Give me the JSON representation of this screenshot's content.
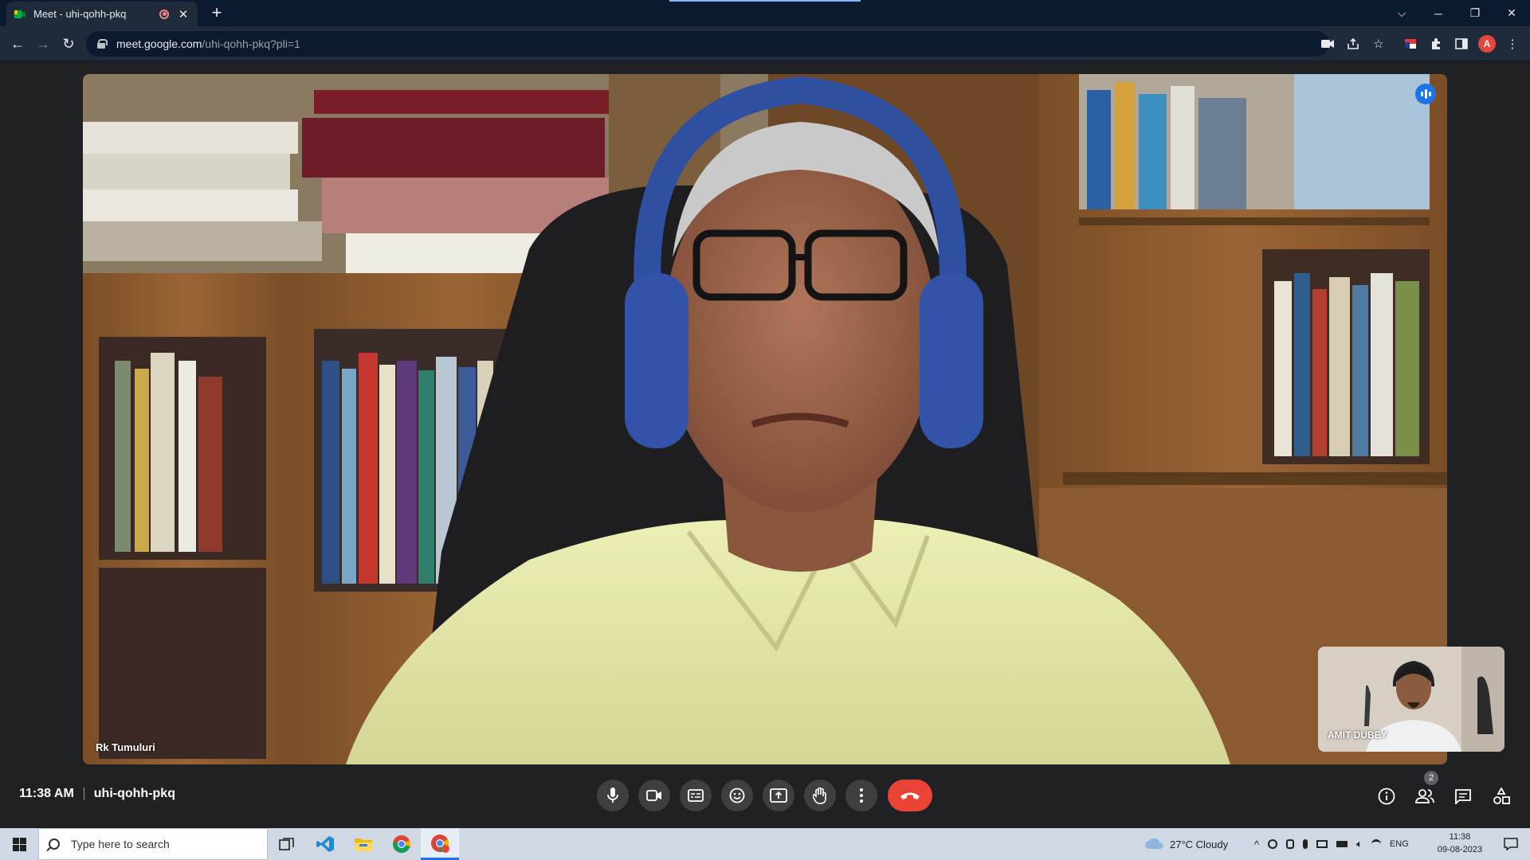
{
  "browser": {
    "tab_title": "Meet - uhi-qohh-pkq",
    "new_tab_label": "+",
    "url_host": "meet.google.com",
    "url_path": "/uhi-qohh-pkq?pli=1",
    "profile_initial": "A"
  },
  "meet": {
    "speaker_name": "Rk Tumuluri",
    "self_name": "AMIT DUBEY",
    "time": "11:38 AM",
    "meeting_code": "uhi-qohh-pkq",
    "participant_count": "2"
  },
  "taskbar": {
    "search_placeholder": "Type here to search",
    "weather": "27°C  Cloudy",
    "language": "ENG",
    "clock_time": "11:38",
    "clock_date": "09-08-2023"
  },
  "icons": {
    "back": "arrow-left-icon",
    "forward": "arrow-right-icon",
    "reload": "reload-icon",
    "mic": "microphone-icon",
    "camera": "camera-icon",
    "captions": "captions-icon",
    "emoji": "emoji-icon",
    "present": "present-screen-icon",
    "hand": "raise-hand-icon",
    "more": "more-options-icon",
    "hangup": "end-call-icon",
    "info": "info-icon",
    "people": "people-icon",
    "chat": "chat-icon",
    "activities": "activities-icon"
  },
  "colors": {
    "meet_bg": "#202124",
    "hangup": "#ea4335",
    "speaking": "#1a73e8"
  }
}
